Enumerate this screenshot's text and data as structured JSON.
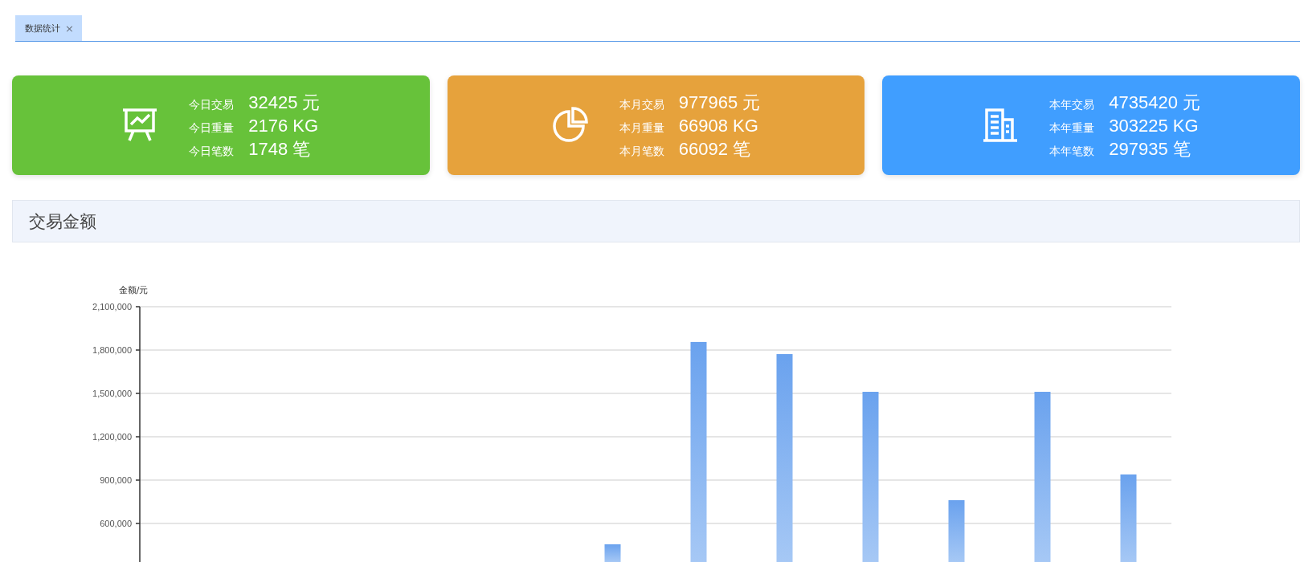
{
  "tabs": [
    {
      "label": "数据统计",
      "close": "×",
      "selected": true
    }
  ],
  "cards": [
    {
      "kind": "board",
      "color": "#67c23a",
      "rows": [
        {
          "label": "今日交易",
          "value": "32425 元"
        },
        {
          "label": "今日重量",
          "value": "2176 KG"
        },
        {
          "label": "今日笔数",
          "value": "1748 笔"
        }
      ]
    },
    {
      "kind": "pie",
      "color": "#e6a23c",
      "rows": [
        {
          "label": "本月交易",
          "value": "977965 元"
        },
        {
          "label": "本月重量",
          "value": "66908 KG"
        },
        {
          "label": "本月笔数",
          "value": "66092 笔"
        }
      ]
    },
    {
      "kind": "building",
      "color": "#409eff",
      "rows": [
        {
          "label": "本年交易",
          "value": "4735420 元"
        },
        {
          "label": "本年重量",
          "value": "303225 KG"
        },
        {
          "label": "本年笔数",
          "value": "297935 笔"
        }
      ]
    }
  ],
  "section": {
    "title": "交易金额",
    "chart_data": {
      "type": "bar",
      "ylabel": "金额/元",
      "ylim": [
        333333,
        2100000
      ],
      "grid": true,
      "yticks": [
        {
          "value": 600000,
          "label": "600,000"
        },
        {
          "value": 900000,
          "label": "900,000"
        },
        {
          "value": 1200000,
          "label": "1,200,000"
        },
        {
          "value": 1500000,
          "label": "1,500,000"
        },
        {
          "value": 1800000,
          "label": "1,800,000"
        },
        {
          "value": 2100000,
          "label": "2,100,000"
        }
      ],
      "series": [
        {
          "color": "#6aa2ee",
          "values": [
            null,
            null,
            null,
            null,
            null,
            456000,
            1856000,
            1772000,
            1511000,
            761000,
            1511000,
            939000
          ]
        }
      ]
    }
  }
}
